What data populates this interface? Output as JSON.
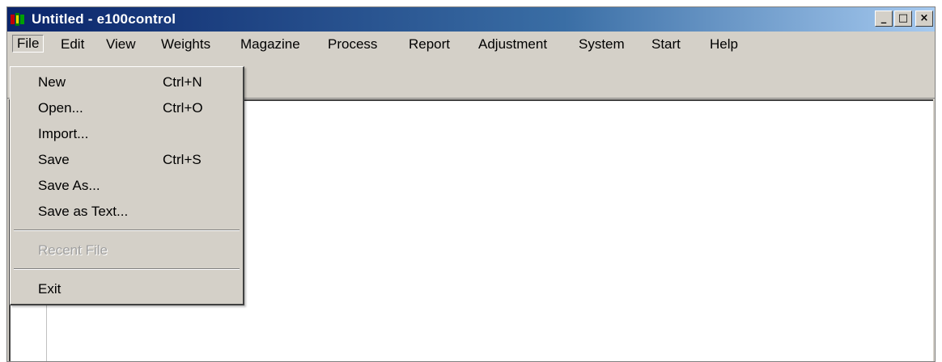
{
  "window": {
    "title": "Untitled - e100control",
    "minimize_label": "_",
    "maximize_label": "□",
    "close_label": "×"
  },
  "menubar": {
    "items": [
      "File",
      "Edit",
      "View",
      "Weights",
      "Magazine",
      "Process",
      "Report",
      "Adjustment",
      "System",
      "Start",
      "Help"
    ]
  },
  "file_menu": {
    "items": [
      {
        "label": "New",
        "shortcut": "Ctrl+N"
      },
      {
        "label": "Open...",
        "shortcut": "Ctrl+O"
      },
      {
        "label": "Import...",
        "shortcut": ""
      },
      {
        "label": "Save",
        "shortcut": "Ctrl+S"
      },
      {
        "label": "Save As...",
        "shortcut": ""
      },
      {
        "label": "Save as Text...",
        "shortcut": ""
      },
      {
        "label": "Recent File",
        "shortcut": "",
        "disabled": true
      },
      {
        "label": "Exit",
        "shortcut": ""
      }
    ]
  },
  "colors": {
    "titlebar_start": "#0a246a",
    "titlebar_end": "#a6caf0",
    "face": "#d4d0c8"
  }
}
